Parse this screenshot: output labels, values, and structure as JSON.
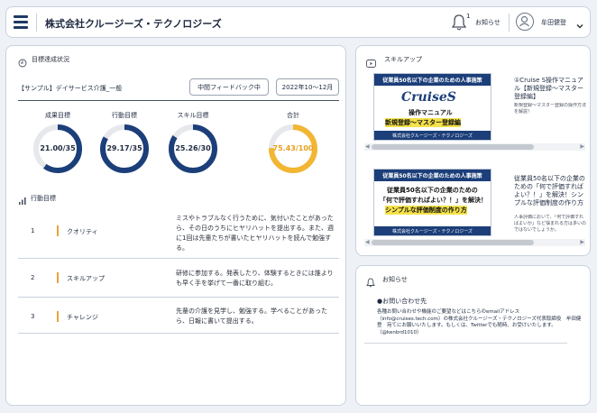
{
  "header": {
    "company": "株式会社クルージーズ・テクノロジーズ",
    "notification_count": "1",
    "notification_label": "お知らせ",
    "user_name": "牟田健登"
  },
  "goals": {
    "panel_title": "目標達成状況",
    "sample_title": "【サンプル】デイサービス介護_一般",
    "midterm_button": "中間フィードバック中",
    "period_button": "2022年10〜12月",
    "metrics": [
      {
        "label": "成果目標",
        "value_text": "21.00/35",
        "fraction": 0.6,
        "color": "#1c3f7a"
      },
      {
        "label": "行動目標",
        "value_text": "29.17/35",
        "fraction": 0.833,
        "color": "#1c3f7a"
      },
      {
        "label": "スキル目標",
        "value_text": "25.26/30",
        "fraction": 0.842,
        "color": "#1c3f7a"
      },
      {
        "label": "合計",
        "value_text": "75.43/100",
        "fraction": 0.7543,
        "color": "#f2b632"
      }
    ],
    "actions_title": "行動目標",
    "actions": [
      {
        "num": "1",
        "name": "クオリティ",
        "desc": "ミスやトラブルなく行うために、気付いたことがあったら、その日のうちにヒヤリハットを提出する。また、週に1回は先輩たちが書いたヒヤリハットを読んで勉強する。"
      },
      {
        "num": "2",
        "name": "スキルアップ",
        "desc": "研修に参加する。発表したり、体験するときには誰よりも早く手を挙げて一番に取り組む。"
      },
      {
        "num": "3",
        "name": "チャレンジ",
        "desc": "先輩の介護を見学し、勉強する。学べることがあったら、日報に書いて提出する。"
      }
    ]
  },
  "skillup": {
    "panel_title": "スキルアップ",
    "items": [
      {
        "banner": "従業員50名以下の企業のための人事施策",
        "logo": "CruiseS",
        "lines": [
          "操作マニュアル",
          "新規登録〜マスター登録編"
        ],
        "footer": "株式会社クルージーズ・テクノロジーズ",
        "side_title": "①Cruise S操作マニュアル【新規登録〜マスター登録編】",
        "side_desc": "新規登録〜マスター登録の操作方法を解説！"
      },
      {
        "banner": "従業員50名以下の企業のための人事施策",
        "lines": [
          "従業員50名以下の企業のための",
          "「何で評価すればよい？！」を解決！",
          "シンプルな評価制度の作り方"
        ],
        "footer": "株式会社クルージーズ・テクノロジーズ",
        "side_title": "従業員50名以下の企業のための「何で評価すればよい？！」を解決！シンプルな評価制度の作り方",
        "side_desc": "人事評価において、「何で評価すればよいか」など悩まれる方は多いのではないでしょうか。"
      }
    ]
  },
  "notices": {
    "panel_title": "お知らせ",
    "heading": "●お問い合わせ先",
    "body": "各種お問い合わせや機能のご要望などはこちらのemailアドレス（info@cruises.tech.com）の株式会社クルージーズ・テクノロジーズ代表取締役　牟田健登　宛てにお願いいたします。もしくは、Twitterでも随時、お受けいたします。（@kenbrd1010）"
  }
}
